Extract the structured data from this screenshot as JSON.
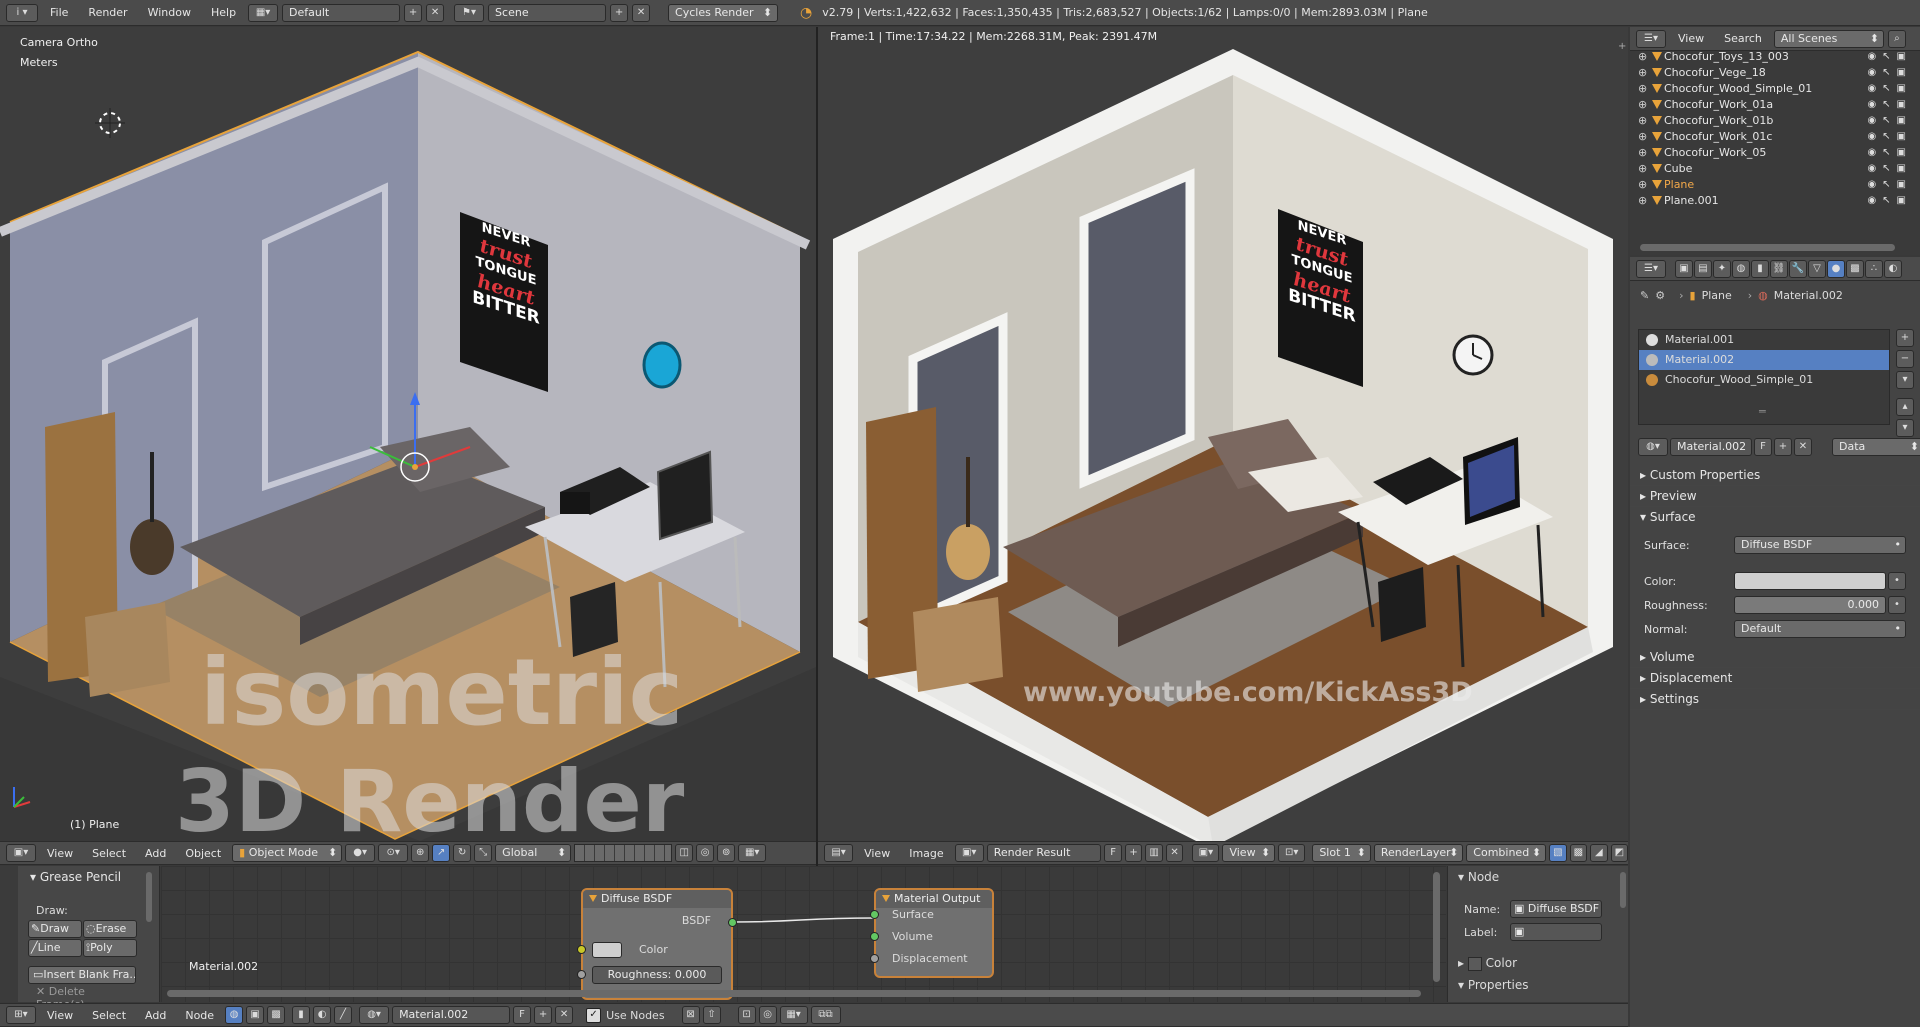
{
  "topbar": {
    "menus": [
      "File",
      "Render",
      "Window",
      "Help"
    ],
    "layout": "Default",
    "scene": "Scene",
    "engine": "Cycles Render",
    "stats": "v2.79 | Verts:1,422,632 | Faces:1,350,435 | Tris:2,683,527 | Objects:1/62 | Lamps:0/0 | Mem:2893.03M | Plane"
  },
  "viewport": {
    "view_name": "Camera Ortho",
    "units": "Meters",
    "selected": "(1) Plane",
    "watermark_1": "isometric",
    "watermark_2": "3D Render",
    "menus": [
      "View",
      "Select",
      "Add",
      "Object"
    ],
    "mode": "Object Mode",
    "orientation": "Global"
  },
  "render": {
    "info": "Frame:1 | Time:17:34.22 | Mem:2268.31M, Peak: 2391.47M",
    "watermark": "www.youtube.com/KickAss3D",
    "menus": [
      "View",
      "Image"
    ],
    "image": "Render Result",
    "f": "F",
    "view": "View",
    "slot": "Slot 1",
    "layer": "RenderLayer",
    "pass": "Combined"
  },
  "poster": {
    "l1": "NEVER",
    "l2": "trust",
    "l3": "TONGUE",
    "l4": "heart",
    "l5": "BITTER"
  },
  "outliner": {
    "menus": [
      "View",
      "Search"
    ],
    "filter": "All Scenes",
    "items": [
      "Chocofur_Toys_13_003",
      "Chocofur_Vege_18",
      "Chocofur_Wood_Simple_01",
      "Chocofur_Work_01a",
      "Chocofur_Work_01b",
      "Chocofur_Work_01c",
      "Chocofur_Work_05",
      "Cube",
      "Plane",
      "Plane.001"
    ]
  },
  "properties": {
    "breadcrumb_object": "Plane",
    "breadcrumb_material": "Material.002",
    "slots": [
      "Material.001",
      "Material.002",
      "Chocofur_Wood_Simple_01"
    ],
    "material_name": "Material.002",
    "f": "F",
    "link": "Data",
    "panels": {
      "custom": "Custom Properties",
      "preview": "Preview",
      "surface": "Surface",
      "volume": "Volume",
      "displacement": "Displacement",
      "settings": "Settings"
    },
    "surface_label": "Surface:",
    "surface_value": "Diffuse BSDF",
    "color_label": "Color:",
    "roughness_label": "Roughness:",
    "roughness_value": "0.000",
    "normal_label": "Normal:",
    "normal_value": "Default"
  },
  "grease": {
    "title": "Grease Pencil",
    "draw": "Draw:",
    "btn_draw": "Draw",
    "btn_erase": "Erase",
    "btn_line": "Line",
    "btn_poly": "Poly",
    "insert": "Insert Blank Fra...",
    "delete": "Delete Frame(s)"
  },
  "nodes": {
    "material_label": "Material.002",
    "diffuse": {
      "title": "Diffuse BSDF",
      "out": "BSDF",
      "color": "Color",
      "roughness": "Roughness:",
      "roughness_value": "0.000"
    },
    "output": {
      "title": "Material Output",
      "surface": "Surface",
      "volume": "Volume",
      "displacement": "Displacement"
    }
  },
  "node_panel": {
    "title": "Node",
    "name_label": "Name:",
    "name_value": "Diffuse BSDF",
    "label_label": "Label:",
    "color": "Color",
    "properties": "Properties"
  },
  "node_footer": {
    "menus": [
      "View",
      "Select",
      "Add",
      "Node"
    ],
    "material": "Material.002",
    "f": "F",
    "use_nodes": "Use Nodes"
  },
  "colors": {
    "accent": "#5680c2",
    "node_border": "#c8823a",
    "socket_green": "#63c763",
    "socket_yellow": "#c7c729"
  }
}
